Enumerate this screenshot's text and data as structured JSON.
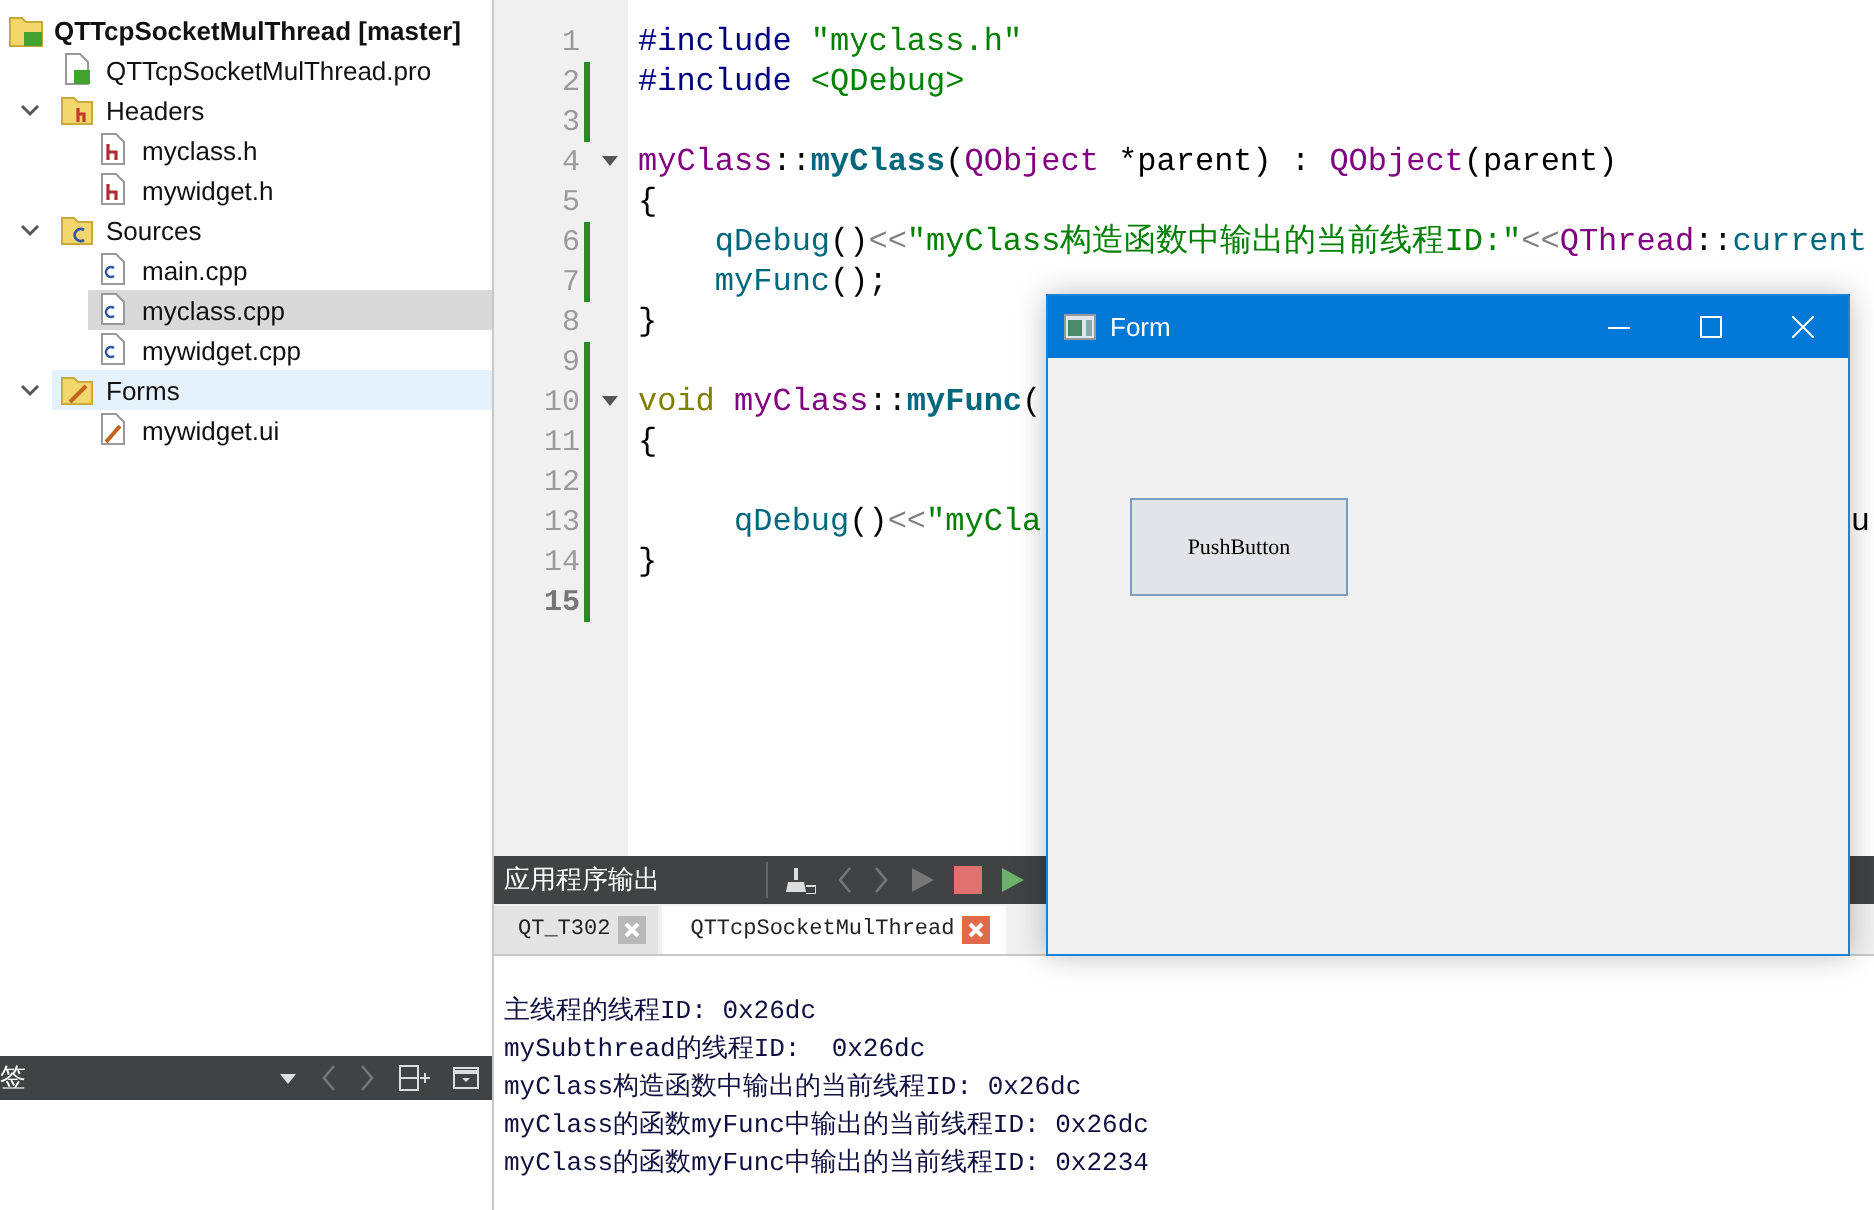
{
  "sidebar": {
    "tree": [
      {
        "label": "QTTcpSocketMulThread [master]",
        "kind": "project",
        "selected": false,
        "highlighted": false,
        "children": [
          {
            "label": "QTTcpSocketMulThread.pro",
            "kind": "pro",
            "selected": false,
            "highlighted": false
          },
          {
            "label": "Headers",
            "kind": "folder-h",
            "expanded": true,
            "selected": false,
            "highlighted": false,
            "children": [
              {
                "label": "myclass.h",
                "kind": "header",
                "selected": false,
                "highlighted": false
              },
              {
                "label": "mywidget.h",
                "kind": "header",
                "selected": false,
                "highlighted": false
              }
            ]
          },
          {
            "label": "Sources",
            "kind": "folder-cpp",
            "expanded": true,
            "selected": false,
            "highlighted": false,
            "children": [
              {
                "label": "main.cpp",
                "kind": "source",
                "selected": false,
                "highlighted": false
              },
              {
                "label": "myclass.cpp",
                "kind": "source",
                "selected": true,
                "highlighted": false
              },
              {
                "label": "mywidget.cpp",
                "kind": "source",
                "selected": false,
                "highlighted": false
              }
            ]
          },
          {
            "label": "Forms",
            "kind": "folder-form",
            "expanded": true,
            "selected": false,
            "highlighted": true,
            "children": [
              {
                "label": "mywidget.ui",
                "kind": "form",
                "selected": false,
                "highlighted": false
              }
            ]
          }
        ]
      }
    ],
    "bottom_bar": {
      "title": "签"
    }
  },
  "editor": {
    "lines": [
      {
        "number": "1",
        "changed": false,
        "foldable": false,
        "current": false,
        "tokens": [
          {
            "kind": "pre",
            "text": "#include "
          },
          {
            "kind": "str",
            "text": "\"myclass.h\""
          }
        ]
      },
      {
        "number": "2",
        "changed": true,
        "foldable": false,
        "current": false,
        "tokens": [
          {
            "kind": "pre",
            "text": "#include "
          },
          {
            "kind": "str",
            "text": "<QDebug>"
          }
        ]
      },
      {
        "number": "3",
        "changed": true,
        "foldable": false,
        "current": false
      },
      {
        "number": "4",
        "changed": false,
        "foldable": true,
        "current": false,
        "tokens": [
          {
            "kind": "type",
            "text": "myClass"
          },
          {
            "kind": "plain",
            "text": "::"
          },
          {
            "kind": "fnb",
            "text": "myClass"
          },
          {
            "kind": "plain",
            "text": "("
          },
          {
            "kind": "type",
            "text": "QObject"
          },
          {
            "kind": "plain",
            "text": " *parent) : "
          },
          {
            "kind": "type",
            "text": "QObject"
          },
          {
            "kind": "plain",
            "text": "(parent)"
          }
        ]
      },
      {
        "number": "5",
        "changed": false,
        "foldable": false,
        "current": false,
        "tokens": [
          {
            "kind": "plain",
            "text": "{"
          }
        ]
      },
      {
        "number": "6",
        "changed": true,
        "foldable": false,
        "current": false,
        "tokens": [
          {
            "kind": "fn",
            "text": "    qDebug"
          },
          {
            "kind": "plain",
            "text": "()"
          },
          {
            "kind": "op",
            "text": "<<"
          },
          {
            "kind": "str",
            "text": "\"myClass构造函数中输出的当前线程ID:\""
          },
          {
            "kind": "op",
            "text": "<<"
          },
          {
            "kind": "type",
            "text": "QThread"
          },
          {
            "kind": "plain",
            "text": "::"
          },
          {
            "kind": "fn",
            "text": "current"
          }
        ]
      },
      {
        "number": "7",
        "changed": true,
        "foldable": false,
        "current": false,
        "tokens": [
          {
            "kind": "fn",
            "text": "    myFunc"
          },
          {
            "kind": "plain",
            "text": "();"
          }
        ]
      },
      {
        "number": "8",
        "changed": false,
        "foldable": false,
        "current": false,
        "tokens": [
          {
            "kind": "plain",
            "text": "}"
          }
        ]
      },
      {
        "number": "9",
        "changed": true,
        "foldable": false,
        "current": false
      },
      {
        "number": "10",
        "changed": true,
        "foldable": true,
        "current": false,
        "tokens": [
          {
            "kind": "kw",
            "text": "void"
          },
          {
            "kind": "type",
            "text": " myClass"
          },
          {
            "kind": "plain",
            "text": "::"
          },
          {
            "kind": "fnb",
            "text": "myFunc"
          },
          {
            "kind": "plain",
            "text": "("
          }
        ]
      },
      {
        "number": "11",
        "changed": true,
        "foldable": false,
        "current": false,
        "tokens": [
          {
            "kind": "plain",
            "text": "{"
          }
        ]
      },
      {
        "number": "12",
        "changed": true,
        "foldable": false,
        "current": false
      },
      {
        "number": "13",
        "changed": true,
        "foldable": false,
        "current": false,
        "tokens": [
          {
            "kind": "fn",
            "text": "     qDebug"
          },
          {
            "kind": "plain",
            "text": "()"
          },
          {
            "kind": "op",
            "text": "<<"
          },
          {
            "kind": "str",
            "text": "\"myCla"
          }
        ],
        "tail": "u"
      },
      {
        "number": "14",
        "changed": true,
        "foldable": false,
        "current": false,
        "tokens": [
          {
            "kind": "plain",
            "text": "}"
          }
        ]
      },
      {
        "number": "15",
        "changed": true,
        "foldable": false,
        "current": true
      }
    ]
  },
  "output": {
    "title": "应用程序输出",
    "tabs": [
      {
        "label": "QT_T302",
        "selected": false
      },
      {
        "label": "QTTcpSocketMulThread",
        "selected": true
      }
    ],
    "lines": [
      "主线程的线程ID: 0x26dc",
      "mySubthread的线程ID:  0x26dc",
      "myClass构造函数中输出的当前线程ID: 0x26dc",
      "myClass的函数myFunc中输出的当前线程ID: 0x26dc",
      "myClass的函数myFunc中输出的当前线程ID: 0x2234"
    ]
  },
  "form_window": {
    "title": "Form",
    "button": "PushButton"
  }
}
